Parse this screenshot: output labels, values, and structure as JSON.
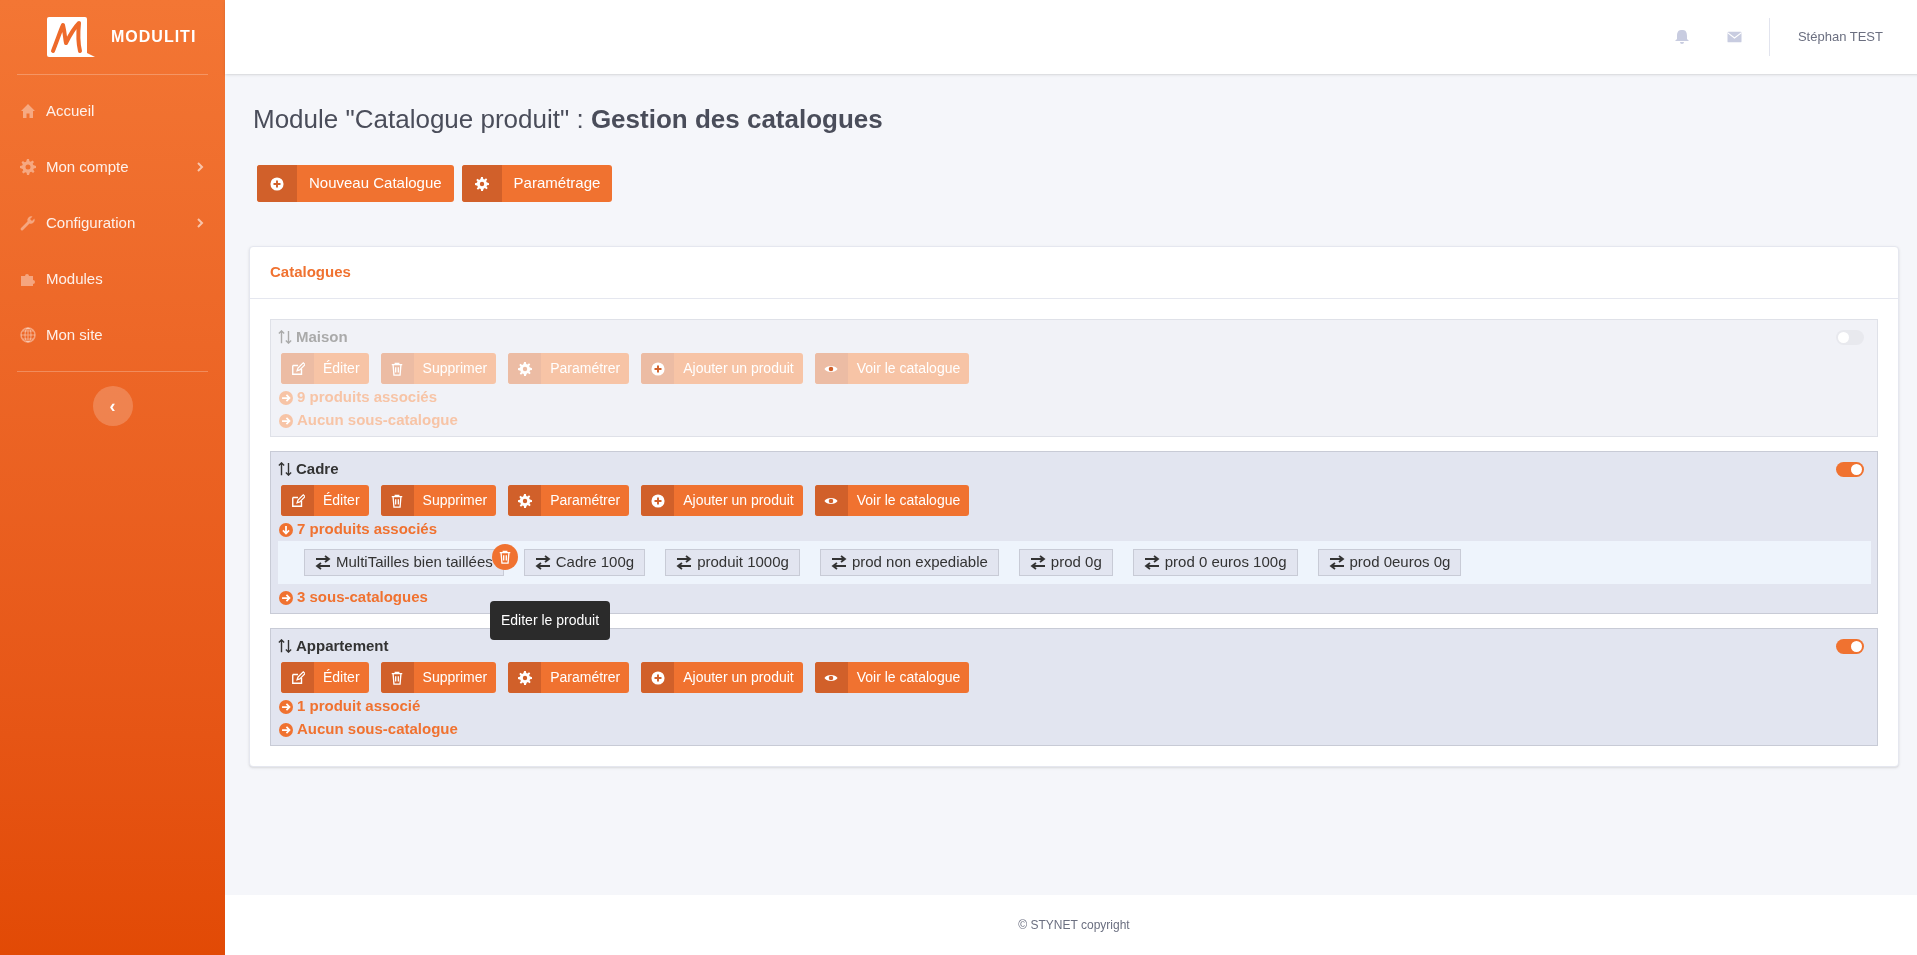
{
  "brand": {
    "name": "MODULITI"
  },
  "sidebar": {
    "items": [
      {
        "label": "Accueil",
        "has_submenu": false
      },
      {
        "label": "Mon compte",
        "has_submenu": true
      },
      {
        "label": "Configuration",
        "has_submenu": true
      },
      {
        "label": "Modules",
        "has_submenu": false
      },
      {
        "label": "Mon site",
        "has_submenu": false
      }
    ],
    "collapse_button": "‹"
  },
  "header": {
    "user": "Stéphan TEST"
  },
  "page_title": "Module \"Catalogue produit\" : **Gestion des catalogues**",
  "actions": [
    {
      "label": "Nouveau Catalogue"
    },
    {
      "label": "Paramétrage"
    }
  ],
  "card": {
    "title": "Catalogues",
    "catalogs": [
      {
        "name": "Maison",
        "enabled": false,
        "expanded": false,
        "buttons": [
          "Éditer",
          "Supprimer",
          "Paramétrer",
          "Ajouter un produit",
          "Voir le catalogue"
        ],
        "products_label": "9 produits associés",
        "subcatalogs_label": "Aucun sous-catalogue"
      },
      {
        "name": "Cadre",
        "enabled": true,
        "expanded": true,
        "buttons": [
          "Éditer",
          "Supprimer",
          "Paramétrer",
          "Ajouter un produit",
          "Voir le catalogue"
        ],
        "products_label": "7 produits associés",
        "subcatalogs_label": "3 sous-catalogues",
        "products": [
          {
            "name": "MultiTailles bien taillées",
            "hovered": true,
            "tooltip": "Editer le produit"
          },
          {
            "name": "Cadre 100g",
            "hovered": false
          },
          {
            "name": "produit 1000g",
            "hovered": false
          },
          {
            "name": "prod non expediable",
            "hovered": false
          },
          {
            "name": "prod 0g",
            "hovered": false
          },
          {
            "name": "prod 0 euros 100g",
            "hovered": false
          },
          {
            "name": "prod 0euros 0g",
            "hovered": false
          }
        ]
      },
      {
        "name": "Appartement",
        "enabled": true,
        "expanded": false,
        "buttons": [
          "Éditer",
          "Supprimer",
          "Paramétrer",
          "Ajouter un produit",
          "Voir le catalogue"
        ],
        "products_label": "1 produit associé",
        "subcatalogs_label": "Aucun sous-catalogue"
      }
    ]
  },
  "footer": "© STYNET copyright"
}
